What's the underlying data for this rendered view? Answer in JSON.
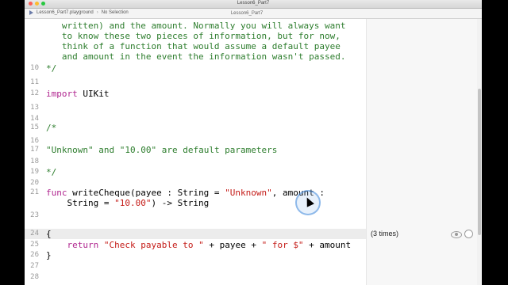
{
  "window": {
    "title": "Lesson6_Part7",
    "tab": "Lesson6_Part7"
  },
  "jumpbar": {
    "file": "Lesson6_Part7.playground",
    "selection": "No Selection"
  },
  "colors": {
    "comment": "#2d7d2d",
    "keyword": "#b0268f",
    "string": "#c41a16",
    "line_highlight": "#ececec"
  },
  "code": {
    "partial_line_1": "   written) and the amount. Normally you will always want",
    "partial_line_2": "   to know these two pieces of information, but for now,",
    "partial_line_3": "   think of a function that would assume a default payee",
    "partial_line_4": "   and amount in the event the information wasn't passed.",
    "l10": "*/",
    "l12_kw": "import",
    "l12_rest": " UIKit",
    "l15": "/*",
    "l17_s1": "\"Unknown\"",
    "l17_mid": " and ",
    "l17_s2": "\"10.00\"",
    "l17_rest": " are default parameters",
    "l19": "*/",
    "l21_kw": "func",
    "l21_a": " writeCheque(payee : String = ",
    "l21_s": "\"Unknown\"",
    "l21_b": ", amount :",
    "l22_a": "    String = ",
    "l22_s": "\"10.00\"",
    "l22_b": ") -> String",
    "l24": "{",
    "l25_kw": "return",
    "l25_s1": "\"Check payable to \"",
    "l25_a": " + payee + ",
    "l25_s2": "\" for $\"",
    "l25_b": " + amount",
    "l26": "}"
  },
  "line_numbers": {
    "n10": "10",
    "n11": "11",
    "n12": "12",
    "n13": "13",
    "n14": "14",
    "n15": "15",
    "n16": "16",
    "n17": "17",
    "n18": "18",
    "n19": "19",
    "n20": "20",
    "n21": "21",
    "n23": "23",
    "n24": "24",
    "n25": "25",
    "n26": "26",
    "n27": "27",
    "n28": "28"
  },
  "results": {
    "line24": "(3 times)"
  }
}
